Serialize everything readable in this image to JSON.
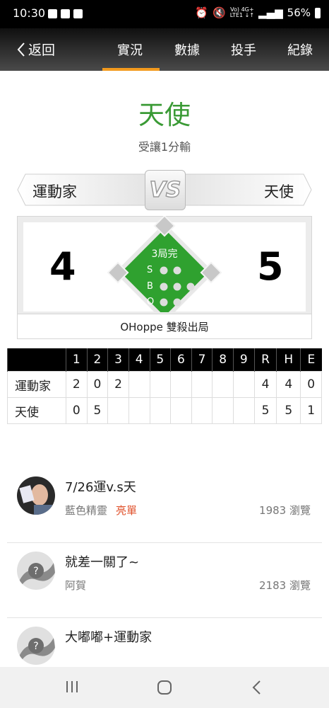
{
  "status_bar": {
    "time": "10:30",
    "battery": "56%",
    "network_top": "Vo) 4G+",
    "network_bottom": "LTE1 ↓↑"
  },
  "nav": {
    "back_label": "返回",
    "tabs": [
      {
        "label": "實況",
        "active": true
      },
      {
        "label": "數據",
        "active": false
      },
      {
        "label": "投手",
        "active": false
      },
      {
        "label": "紀錄",
        "active": false
      }
    ]
  },
  "game": {
    "winner": "天使",
    "handicap_note": "受讓1分輸",
    "vs": "VS",
    "away": {
      "name": "運動家",
      "score": "4"
    },
    "home": {
      "name": "天使",
      "score": "5"
    },
    "inning_status": "3局完",
    "count_labels": [
      "S",
      "B",
      "O"
    ],
    "last_play": "OHoppe 雙殺出局"
  },
  "linescore": {
    "headers": [
      "",
      "1",
      "2",
      "3",
      "4",
      "5",
      "6",
      "7",
      "8",
      "9",
      "R",
      "H",
      "E"
    ],
    "rows": [
      [
        "運動家",
        "2",
        "0",
        "2",
        "",
        "",
        "",
        "",
        "",
        "",
        "4",
        "4",
        "0"
      ],
      [
        "天使",
        "0",
        "5",
        "",
        "",
        "",
        "",
        "",
        "",
        "",
        "5",
        "5",
        "1"
      ]
    ]
  },
  "posts": [
    {
      "title": "7/26運v.s天",
      "author": "藍色精靈",
      "tag": "亮單",
      "views": "1983 瀏覽"
    },
    {
      "title": "就差一關了~",
      "author": "阿賀",
      "tag": "",
      "views": "2183 瀏覽"
    },
    {
      "title": "大嘟嘟+運動家",
      "author": "",
      "tag": "",
      "views": ""
    }
  ],
  "colors": {
    "win_green": "#3a9a35",
    "tab_indicator": "#f39a1e",
    "tag_red": "#e0512b",
    "field_green": "#2fa12f"
  }
}
